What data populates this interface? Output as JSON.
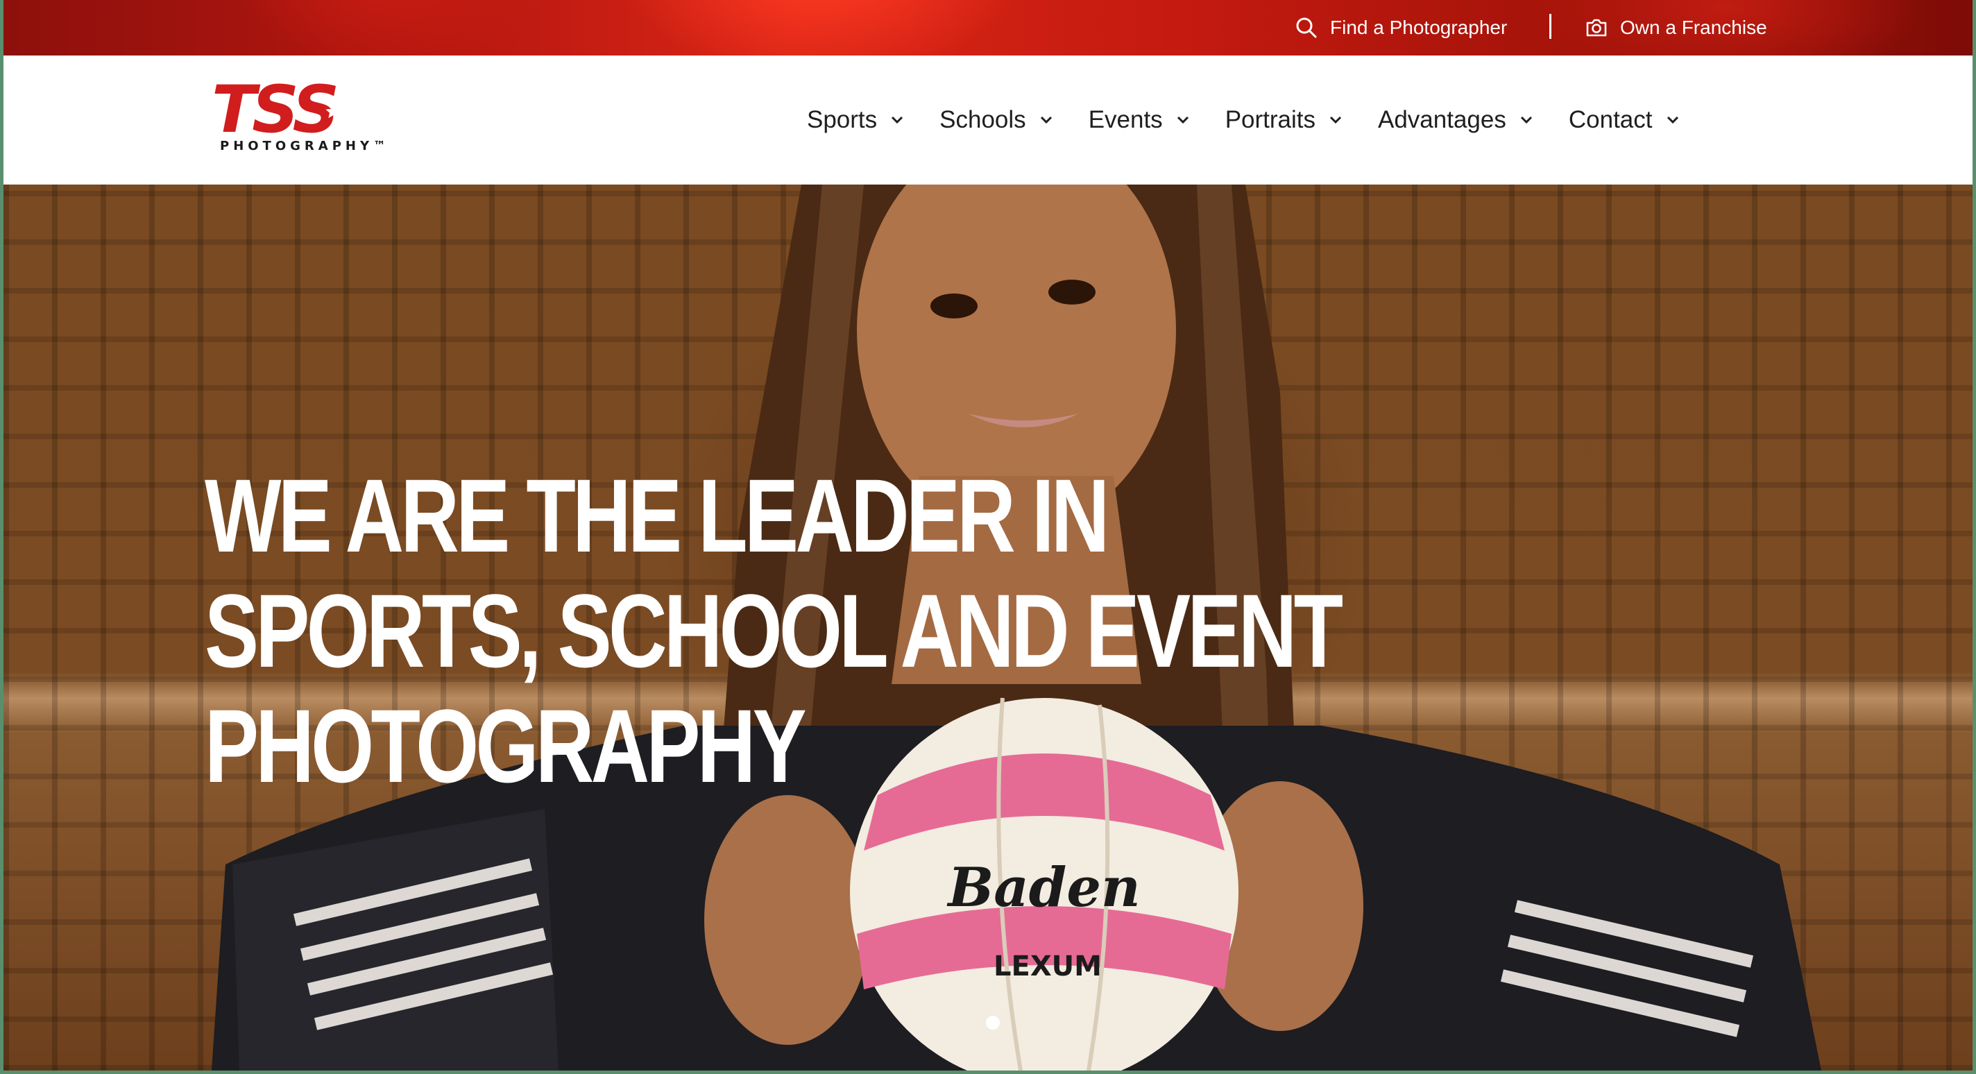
{
  "utility": {
    "find_photographer": "Find a Photographer",
    "own_franchise": "Own a Franchise"
  },
  "logo": {
    "mark": "TSS",
    "sub": "PHOTOGRAPHY™"
  },
  "nav": {
    "items": [
      {
        "label": "Sports"
      },
      {
        "label": "Schools"
      },
      {
        "label": "Events"
      },
      {
        "label": "Portraits"
      },
      {
        "label": "Advantages"
      },
      {
        "label": "Contact"
      }
    ]
  },
  "hero": {
    "heading_lines": [
      "WE ARE THE LEADER IN",
      "SPORTS, SCHOOL AND EVENT",
      "PHOTOGRAPHY"
    ],
    "ball_brand": "Baden",
    "ball_model": "LEXUM",
    "slide_count": 1,
    "active_slide": 1
  },
  "colors": {
    "brand_red": "#d11d1d",
    "ball_pink": "#e56b95"
  },
  "icons": {
    "find_photographer": "search-icon",
    "own_franchise": "camera-icon",
    "nav_dropdown": "chevron-down-icon"
  }
}
